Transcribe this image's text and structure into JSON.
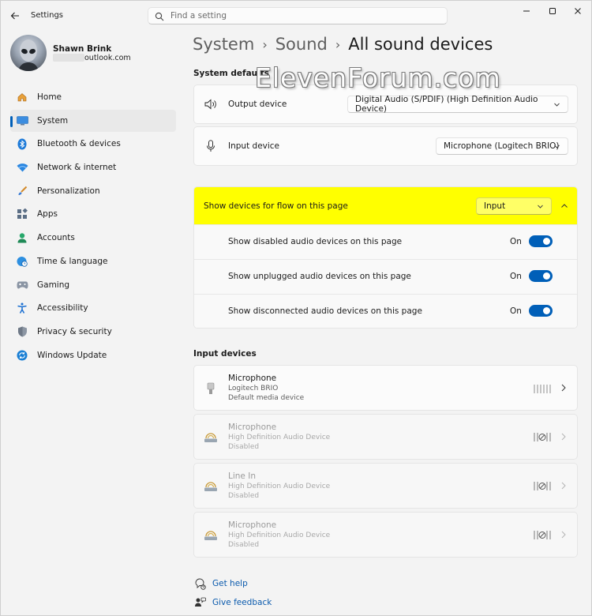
{
  "window": {
    "title": "Settings"
  },
  "search": {
    "placeholder": "Find a setting"
  },
  "user": {
    "name": "Shawn Brink",
    "email_visible": "outlook.com"
  },
  "sidebar": {
    "items": [
      {
        "label": "Home",
        "icon": "home-icon"
      },
      {
        "label": "System",
        "icon": "system-icon",
        "active": true
      },
      {
        "label": "Bluetooth & devices",
        "icon": "bluetooth-icon"
      },
      {
        "label": "Network & internet",
        "icon": "wifi-icon"
      },
      {
        "label": "Personalization",
        "icon": "brush-icon"
      },
      {
        "label": "Apps",
        "icon": "apps-icon"
      },
      {
        "label": "Accounts",
        "icon": "accounts-icon"
      },
      {
        "label": "Time & language",
        "icon": "globe-clock-icon"
      },
      {
        "label": "Gaming",
        "icon": "gamepad-icon"
      },
      {
        "label": "Accessibility",
        "icon": "accessibility-icon"
      },
      {
        "label": "Privacy & security",
        "icon": "shield-icon"
      },
      {
        "label": "Windows Update",
        "icon": "update-icon"
      }
    ]
  },
  "breadcrumb": {
    "items": [
      "System",
      "Sound",
      "All sound devices"
    ]
  },
  "watermark": "ElevenForum.com",
  "system_defaults": {
    "title": "System defaults",
    "output": {
      "label": "Output device",
      "value": "Digital Audio (S/PDIF) (High Definition Audio Device)",
      "icon": "speaker-icon"
    },
    "input": {
      "label": "Input device",
      "value": "Microphone (Logitech BRIO)",
      "icon": "microphone-icon"
    }
  },
  "flow": {
    "label": "Show devices for flow on this page",
    "value": "Input",
    "rows": [
      {
        "label": "Show disabled audio devices on this page",
        "state": "On"
      },
      {
        "label": "Show unplugged audio devices on this page",
        "state": "On"
      },
      {
        "label": "Show disconnected audio devices on this page",
        "state": "On"
      }
    ]
  },
  "input_devices": {
    "title": "Input devices",
    "items": [
      {
        "name": "Microphone",
        "line1": "Logitech BRIO",
        "line2": "Default media device",
        "disabled": false
      },
      {
        "name": "Microphone",
        "line1": "High Definition Audio Device",
        "line2": "Disabled",
        "disabled": true
      },
      {
        "name": "Line In",
        "line1": "High Definition Audio Device",
        "line2": "Disabled",
        "disabled": true
      },
      {
        "name": "Microphone",
        "line1": "High Definition Audio Device",
        "line2": "Disabled",
        "disabled": true
      }
    ]
  },
  "footer": {
    "help": "Get help",
    "feedback": "Give feedback"
  },
  "colors": {
    "accent": "#005fb8",
    "highlight": "#ffff00",
    "link": "#0a5aad"
  }
}
